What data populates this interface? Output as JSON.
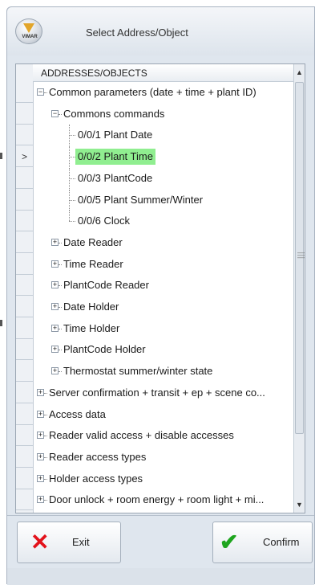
{
  "window": {
    "title": "Select Address/Object",
    "logo_text": "VIMAR"
  },
  "grid": {
    "column_header": "ADDRESSES/OBJECTS",
    "selected_indicator": ">",
    "rows": [
      {
        "label": "Common parameters (date + time + plant ID)",
        "expander": "−"
      },
      {
        "label": "Commons commands",
        "expander": "−"
      },
      {
        "label": "0/0/1 Plant Date",
        "expander": ""
      },
      {
        "label": "0/0/2 Plant Time",
        "expander": "",
        "selected": true
      },
      {
        "label": "0/0/3 PlantCode",
        "expander": ""
      },
      {
        "label": "0/0/5 Plant Summer/Winter",
        "expander": ""
      },
      {
        "label": "0/0/6 Clock",
        "expander": ""
      },
      {
        "label": "Date Reader",
        "expander": "+"
      },
      {
        "label": "Time Reader",
        "expander": "+"
      },
      {
        "label": "PlantCode Reader",
        "expander": "+"
      },
      {
        "label": "Date Holder",
        "expander": "+"
      },
      {
        "label": "Time Holder",
        "expander": "+"
      },
      {
        "label": "PlantCode Holder",
        "expander": "+"
      },
      {
        "label": "Thermostat summer/winter state",
        "expander": "+"
      },
      {
        "label": "Server confirmation + transit + ep + scene co...",
        "expander": "+"
      },
      {
        "label": "Access data",
        "expander": "+"
      },
      {
        "label": "Reader valid access + disable accesses",
        "expander": "+"
      },
      {
        "label": "Reader access types",
        "expander": "+"
      },
      {
        "label": "Holder access types",
        "expander": "+"
      },
      {
        "label": "Door unlock + room energy + room light + mi...",
        "expander": "+"
      }
    ]
  },
  "buttons": {
    "exit_label": "Exit",
    "confirm_label": "Confirm",
    "exit_icon": "x-icon",
    "confirm_icon": "check-icon"
  },
  "colors": {
    "selected_row": "#90ee90",
    "exit_icon": "#e3121b",
    "confirm_icon": "#1ea51e"
  }
}
